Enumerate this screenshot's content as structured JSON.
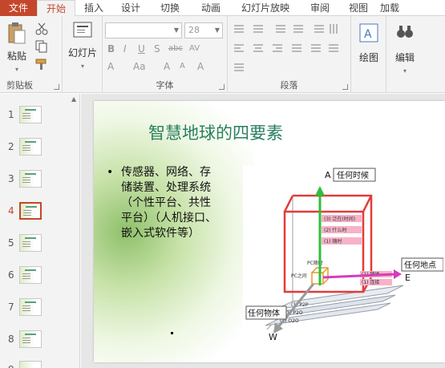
{
  "tabs": [
    {
      "label": "文件",
      "kind": "file"
    },
    {
      "label": "开始",
      "kind": "active"
    },
    {
      "label": "插入",
      "kind": "normal"
    },
    {
      "label": "设计",
      "kind": "normal"
    },
    {
      "label": "切换",
      "kind": "normal"
    },
    {
      "label": "动画",
      "kind": "normal"
    },
    {
      "label": "幻灯片放映",
      "kind": "normal"
    },
    {
      "label": "审阅",
      "kind": "normal"
    },
    {
      "label": "视图",
      "kind": "normal"
    },
    {
      "label": "加载",
      "kind": "normal"
    }
  ],
  "ribbon": {
    "clipboard": {
      "paste_label": "粘贴",
      "group_label": "剪贴板"
    },
    "slides": {
      "button_label": "幻灯片"
    },
    "font": {
      "font_size": "28",
      "group_label": "字体"
    },
    "paragraph": {
      "group_label": "段落"
    },
    "drawing": {
      "button_label": "绘图"
    },
    "editing": {
      "button_label": "编辑"
    }
  },
  "thumbnails": [
    {
      "number": "1",
      "current": false
    },
    {
      "number": "2",
      "current": false
    },
    {
      "number": "3",
      "current": false
    },
    {
      "number": "4",
      "current": true
    },
    {
      "number": "5",
      "current": false
    },
    {
      "number": "6",
      "current": false
    },
    {
      "number": "7",
      "current": false
    },
    {
      "number": "8",
      "current": false
    },
    {
      "number": "9",
      "current": false
    }
  ],
  "slide": {
    "title": "智慧地球的四要素",
    "bullet_lines": [
      "传感器、网络、存",
      "储装置、处理系统",
      "（个性平台、共性",
      "平台）（人机接口、",
      "嵌入式软件等）"
    ],
    "diagram": {
      "axis_a": "A",
      "axis_a_label": "任何时候",
      "axis_e": "E",
      "axis_e_label": "任何地点",
      "axis_w": "W",
      "axis_w_label": "任何物体"
    }
  },
  "colors": {
    "accent": "#c4472b",
    "title": "#2a8060"
  }
}
